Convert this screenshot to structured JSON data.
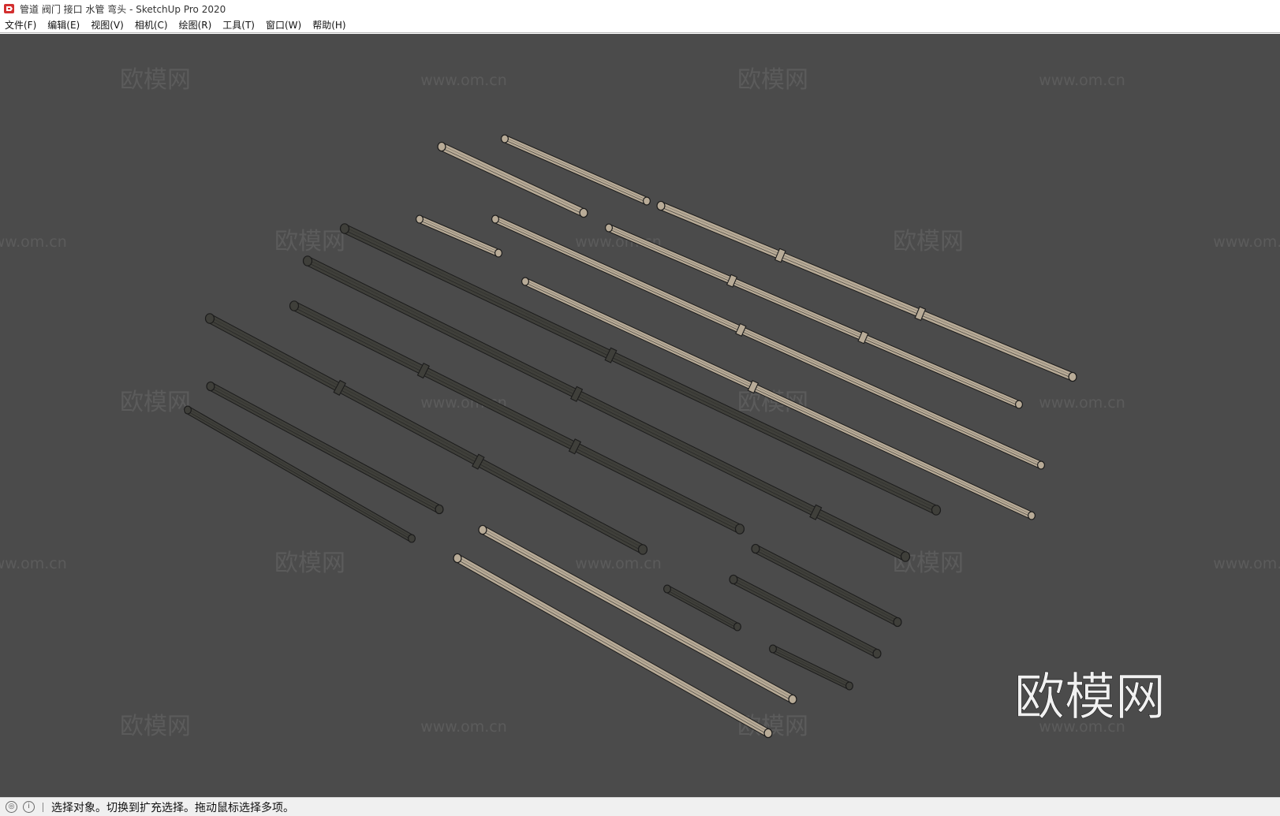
{
  "window": {
    "title": "管道 阀门 接口 水管 弯头 - SketchUp Pro 2020",
    "app_icon": "sketchup-logo-icon"
  },
  "menubar": {
    "items": [
      {
        "label": "文件(F)"
      },
      {
        "label": "编辑(E)"
      },
      {
        "label": "视图(V)"
      },
      {
        "label": "相机(C)"
      },
      {
        "label": "绘图(R)"
      },
      {
        "label": "工具(T)"
      },
      {
        "label": "窗口(W)"
      },
      {
        "label": "帮助(H)"
      }
    ]
  },
  "viewport": {
    "background": "#4b4b4b",
    "watermarks": {
      "brand_text": "欧模网",
      "url_text": "www.om.cn",
      "large_brand_text": "欧模网"
    },
    "colors": {
      "light_pipe": "#b8ab97",
      "dark_pipe": "#3f3f3a",
      "edge": "#1c1c1c"
    }
  },
  "statusbar": {
    "icons": [
      "geo-location-icon",
      "info-icon"
    ],
    "text": "选择对象。切换到扩充选择。拖动鼠标选择多项。"
  }
}
